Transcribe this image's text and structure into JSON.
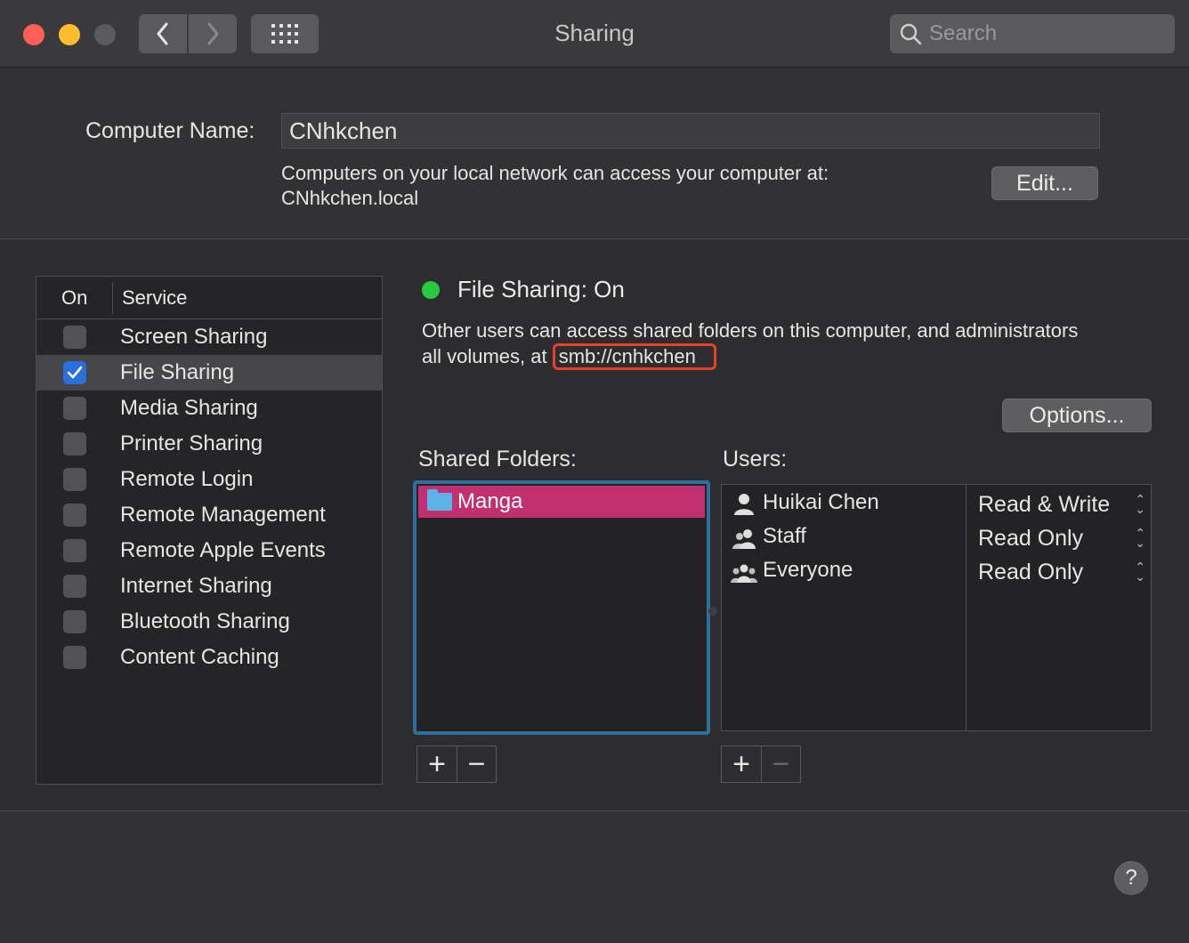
{
  "window": {
    "title": "Sharing"
  },
  "toolbar": {
    "search_placeholder": "Search"
  },
  "computer": {
    "label": "Computer Name:",
    "name": "CNhkchen",
    "desc_line1": "Computers on your local network can access your computer at:",
    "desc_line2": "CNhkchen.local",
    "edit_label": "Edit..."
  },
  "services": {
    "header_on": "On",
    "header_service": "Service",
    "items": [
      {
        "label": "Screen Sharing",
        "checked": false
      },
      {
        "label": "File Sharing",
        "checked": true
      },
      {
        "label": "Media Sharing",
        "checked": false
      },
      {
        "label": "Printer Sharing",
        "checked": false
      },
      {
        "label": "Remote Login",
        "checked": false
      },
      {
        "label": "Remote Management",
        "checked": false
      },
      {
        "label": "Remote Apple Events",
        "checked": false
      },
      {
        "label": "Internet Sharing",
        "checked": false
      },
      {
        "label": "Bluetooth Sharing",
        "checked": false
      },
      {
        "label": "Content Caching",
        "checked": false
      }
    ]
  },
  "status": {
    "text": "File Sharing: On",
    "color": "#2ac840",
    "desc_line1": "Other users can access shared folders on this computer, and administrators",
    "desc_prefix": "all volumes, at ",
    "address": "smb://cnhkchen",
    "highlight_color": "#e8402a"
  },
  "options_label": "Options...",
  "shared_folders": {
    "label": "Shared Folders:",
    "items": [
      "Manga"
    ]
  },
  "users": {
    "label": "Users:",
    "items": [
      {
        "name": "Huikai Chen",
        "permission": "Read & Write",
        "icon": "single-user-icon"
      },
      {
        "name": "Staff",
        "permission": "Read Only",
        "icon": "group-icon"
      },
      {
        "name": "Everyone",
        "permission": "Read Only",
        "icon": "everyone-icon"
      }
    ]
  },
  "buttons": {
    "plus": "+",
    "minus": "−",
    "help": "?"
  }
}
